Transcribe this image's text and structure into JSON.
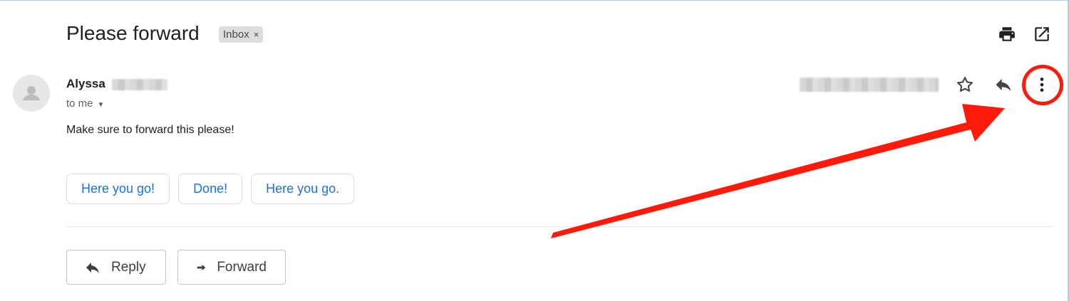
{
  "email": {
    "subject": "Please forward",
    "label": "Inbox",
    "label_remove": "×",
    "sender_name": "Alyssa",
    "recipient": "to me",
    "body": "Make sure to forward this please!"
  },
  "smart_replies": [
    {
      "label": "Here you go!"
    },
    {
      "label": "Done!"
    },
    {
      "label": "Here you go."
    }
  ],
  "footer": {
    "reply_label": "Reply",
    "forward_label": "Forward"
  },
  "icons": {
    "print": "print-icon",
    "open_new_window": "open-in-new-window-icon",
    "star": "star-icon",
    "reply": "reply-icon",
    "more": "more-vertical-icon",
    "forward": "forward-icon"
  },
  "colors": {
    "link": "#1a73e8",
    "annotation": "#ff1a0a"
  }
}
